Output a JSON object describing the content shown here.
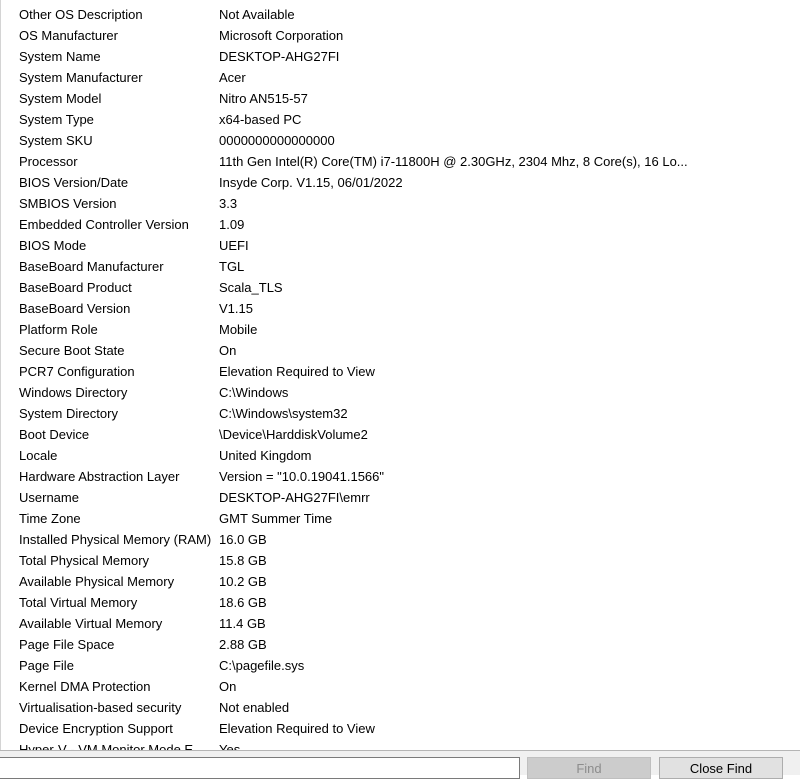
{
  "rows": [
    {
      "item": "Other OS Description",
      "value": "Not Available"
    },
    {
      "item": "OS Manufacturer",
      "value": "Microsoft Corporation"
    },
    {
      "item": "System Name",
      "value": "DESKTOP-AHG27FI"
    },
    {
      "item": "System Manufacturer",
      "value": "Acer"
    },
    {
      "item": "System Model",
      "value": "Nitro AN515-57"
    },
    {
      "item": "System Type",
      "value": "x64-based PC"
    },
    {
      "item": "System SKU",
      "value": "0000000000000000"
    },
    {
      "item": "Processor",
      "value": "11th Gen Intel(R) Core(TM) i7-11800H @ 2.30GHz, 2304 Mhz, 8 Core(s), 16 Lo..."
    },
    {
      "item": "BIOS Version/Date",
      "value": "Insyde Corp. V1.15, 06/01/2022"
    },
    {
      "item": "SMBIOS Version",
      "value": "3.3"
    },
    {
      "item": "Embedded Controller Version",
      "value": "1.09"
    },
    {
      "item": "BIOS Mode",
      "value": "UEFI"
    },
    {
      "item": "BaseBoard Manufacturer",
      "value": "TGL"
    },
    {
      "item": "BaseBoard Product",
      "value": "Scala_TLS"
    },
    {
      "item": "BaseBoard Version",
      "value": "V1.15"
    },
    {
      "item": "Platform Role",
      "value": "Mobile"
    },
    {
      "item": "Secure Boot State",
      "value": "On"
    },
    {
      "item": "PCR7 Configuration",
      "value": "Elevation Required to View"
    },
    {
      "item": "Windows Directory",
      "value": "C:\\Windows"
    },
    {
      "item": "System Directory",
      "value": "C:\\Windows\\system32"
    },
    {
      "item": "Boot Device",
      "value": "\\Device\\HarddiskVolume2"
    },
    {
      "item": "Locale",
      "value": "United Kingdom"
    },
    {
      "item": "Hardware Abstraction Layer",
      "value": "Version = \"10.0.19041.1566\""
    },
    {
      "item": "Username",
      "value": "DESKTOP-AHG27FI\\emrr"
    },
    {
      "item": "Time Zone",
      "value": "GMT Summer Time"
    },
    {
      "item": "Installed Physical Memory (RAM)",
      "value": "16.0 GB"
    },
    {
      "item": "Total Physical Memory",
      "value": "15.8 GB"
    },
    {
      "item": "Available Physical Memory",
      "value": "10.2 GB"
    },
    {
      "item": "Total Virtual Memory",
      "value": "18.6 GB"
    },
    {
      "item": "Available Virtual Memory",
      "value": "11.4 GB"
    },
    {
      "item": "Page File Space",
      "value": "2.88 GB"
    },
    {
      "item": "Page File",
      "value": "C:\\pagefile.sys"
    },
    {
      "item": "Kernel DMA Protection",
      "value": "On"
    },
    {
      "item": "Virtualisation-based security",
      "value": "Not enabled"
    },
    {
      "item": "Device Encryption Support",
      "value": "Elevation Required to View"
    },
    {
      "item": "Hyper-V - VM Monitor Mode E...",
      "value": "Yes"
    }
  ],
  "find_bar": {
    "search_value": "",
    "find_label": "Find",
    "close_find_label": "Close Find"
  }
}
